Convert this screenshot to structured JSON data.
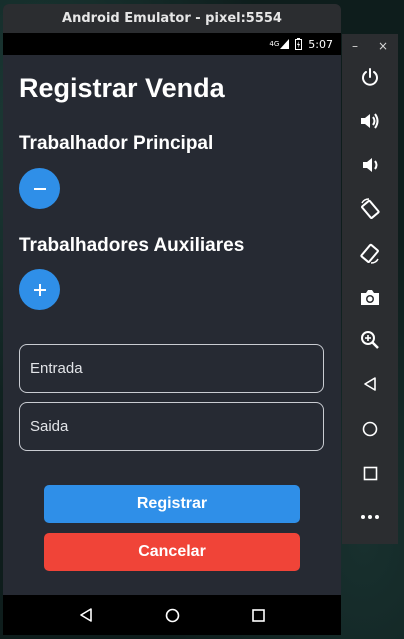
{
  "window": {
    "title": "Android Emulator - pixel:5554"
  },
  "status_bar": {
    "network": "4G",
    "time": "5:07"
  },
  "app": {
    "title": "Registrar Venda",
    "main_worker": {
      "label": "Trabalhador Principal"
    },
    "aux_workers": {
      "label": "Trabalhadores Auxiliares"
    },
    "fields": {
      "entrada": "Entrada",
      "saida": "Saida"
    },
    "buttons": {
      "register": "Registrar",
      "cancel": "Cancelar"
    }
  },
  "side_toolbar": {
    "minimize": "–",
    "close": "×",
    "items": [
      "power-icon",
      "volume-up-icon",
      "volume-down-icon",
      "rotate-left-icon",
      "rotate-right-icon",
      "camera-icon",
      "zoom-icon",
      "back-icon",
      "home-icon",
      "overview-icon",
      "more-icon"
    ]
  },
  "colors": {
    "accent": "#2f8fe8",
    "danger": "#f04438",
    "app_bg": "#262a33"
  }
}
